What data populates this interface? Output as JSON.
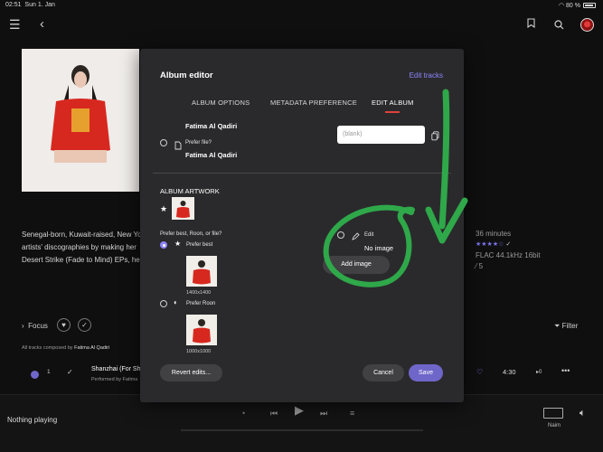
{
  "status_bar": {
    "time": "02:51",
    "date": "Sun 1. Jan",
    "battery": "80 %"
  },
  "background": {
    "bio_lines": [
      "Senegal-born, Kuwait-raised, New Yo",
      "artists' discographies by making her",
      "Desert Strike (Fade to Mind) EPs, he"
    ],
    "duration": "36 minutes",
    "format": "FLAC 44.1kHz 16bit",
    "rating_extra": "5",
    "focus_label": "Focus",
    "filter_label": "Filter",
    "composed_prefix": "All tracks composed by",
    "composer": "Fatima Al Qadiri",
    "track": {
      "number": "1",
      "title": "Shanzhai (For Sh",
      "performed_prefix": "Performed by",
      "performer": "Fatima",
      "duration": "4:30"
    },
    "now_playing": "Nothing playing",
    "zone": "Naim"
  },
  "modal": {
    "title": "Album editor",
    "edit_tracks": "Edit tracks",
    "tabs": [
      "ALBUM OPTIONS",
      "METADATA PREFERENCE",
      "EDIT ALBUM"
    ],
    "artist_top": "Fatima Al Qadiri",
    "prefer_file": "Prefer file?",
    "artist_file": "Fatima Al Qadiri",
    "input_placeholder": "(blank)",
    "artwork_heading": "ALBUM ARTWORK",
    "prefer_question": "Prefer best, Roon, or file?",
    "prefer_best": "Prefer best",
    "prefer_best_size": "1400x1400",
    "prefer_roon": "Prefer Roon",
    "prefer_roon_size": "1000x1000",
    "edit_label": "Edit",
    "no_image": "No image",
    "add_image": "Add image",
    "revert": "Revert edits...",
    "cancel": "Cancel",
    "save": "Save"
  },
  "colors": {
    "accent": "#8f85ff",
    "tab_underline": "#e0413c",
    "annotation": "#2fa84a"
  }
}
